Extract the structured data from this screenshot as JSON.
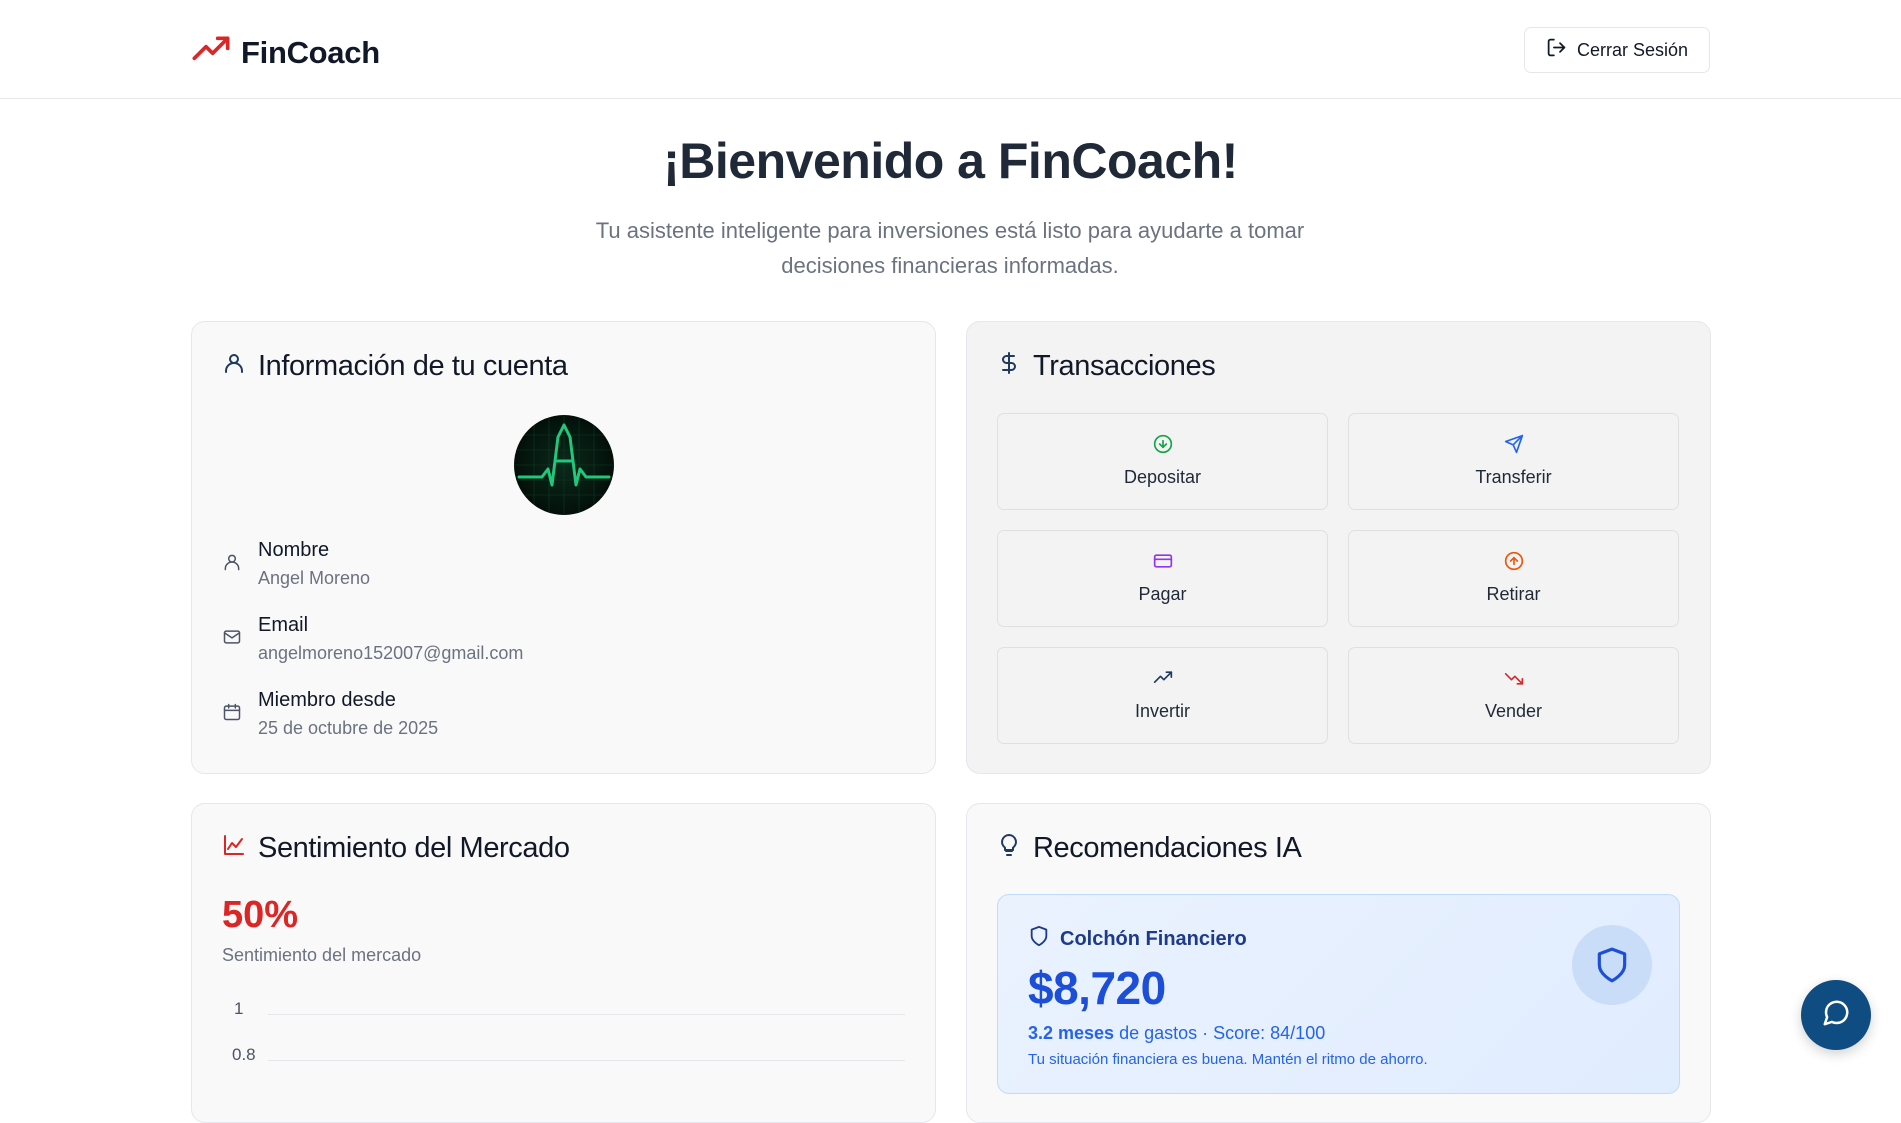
{
  "header": {
    "brand": "FinCoach",
    "brand_icon": "trending-up-icon",
    "brand_color": "#dc2626",
    "logout_label": "Cerrar Sesión",
    "logout_icon": "log-out-icon"
  },
  "hero": {
    "title": "¡Bienvenido a FinCoach!",
    "subtitle_line1": "Tu asistente inteligente para inversiones está listo para ayudarte a tomar",
    "subtitle_line2": "decisiones financieras informadas."
  },
  "account": {
    "title": "Información de tu cuenta",
    "avatar_icon": "avatar-heartbeat-logo",
    "rows": [
      {
        "icon": "user-icon",
        "label": "Nombre",
        "value": "Angel Moreno"
      },
      {
        "icon": "mail-icon",
        "label": "Email",
        "value": "angelmoreno152007@gmail.com"
      },
      {
        "icon": "calendar-icon",
        "label": "Miembro desde",
        "value": "25 de octubre de 2025"
      }
    ]
  },
  "transactions": {
    "title": "Transacciones",
    "buttons": [
      {
        "label": "Depositar",
        "icon": "arrow-down-circle-icon",
        "color": "#16a34a"
      },
      {
        "label": "Transferir",
        "icon": "send-icon",
        "color": "#2563eb"
      },
      {
        "label": "Pagar",
        "icon": "credit-card-icon",
        "color": "#9333ea"
      },
      {
        "label": "Retirar",
        "icon": "arrow-up-circle-icon",
        "color": "#ea580c"
      },
      {
        "label": "Invertir",
        "icon": "trending-up-icon",
        "color": "#1e3a5f"
      },
      {
        "label": "Vender",
        "icon": "trending-down-icon",
        "color": "#dc2626"
      }
    ]
  },
  "sentiment": {
    "title": "Sentimiento del Mercado",
    "value": "50%",
    "value_color": "#dc2626",
    "subtitle": "Sentimiento del mercado"
  },
  "chart_data": {
    "type": "line",
    "title": "",
    "xlabel": "",
    "ylabel": "",
    "y_ticks": [
      "1",
      "0.8"
    ],
    "ylim": [
      0,
      1
    ],
    "grid": true,
    "series": []
  },
  "recommendations": {
    "title": "Recomendaciones IA",
    "card": {
      "heading": "Colchón Financiero",
      "amount": "$8,720",
      "months": "3.2 meses",
      "meta_rest": " de gastos · Score: 84/100",
      "note": "Tu situación financiera es buena. Mantén el ritmo de ahorro."
    }
  },
  "chat": {
    "icon": "message-circle-icon",
    "color": "#0f4c81"
  }
}
